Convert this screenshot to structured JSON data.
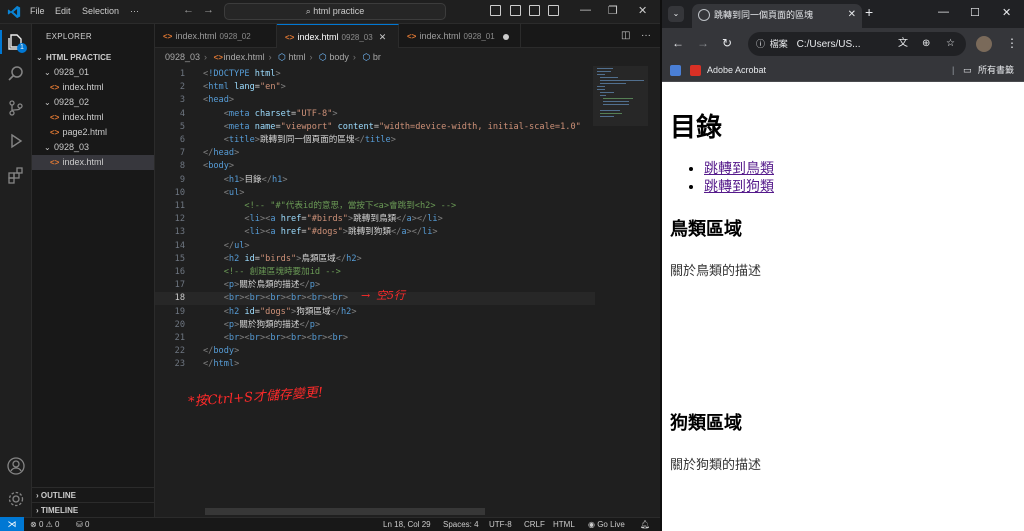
{
  "vscode": {
    "menu": [
      "File",
      "Edit",
      "Selection"
    ],
    "command_center": "html practice",
    "activity_badge": "1",
    "sidebar": {
      "header": "EXPLORER",
      "project": "HTML PRACTICE",
      "tree": [
        {
          "label": "0928_01",
          "kind": "folder"
        },
        {
          "label": "index.html",
          "kind": "file"
        },
        {
          "label": "0928_02",
          "kind": "folder"
        },
        {
          "label": "index.html",
          "kind": "file"
        },
        {
          "label": "page2.html",
          "kind": "file"
        },
        {
          "label": "0928_03",
          "kind": "folder"
        },
        {
          "label": "index.html",
          "kind": "file",
          "selected": true
        }
      ],
      "outline": "OUTLINE",
      "timeline": "TIMELINE"
    },
    "tabs": [
      {
        "name": "index.html",
        "dir": "0928_02"
      },
      {
        "name": "index.html",
        "dir": "0928_03",
        "active": true
      },
      {
        "name": "index.html",
        "dir": "0928_01",
        "dirty": true
      }
    ],
    "breadcrumb": [
      "0928_03",
      "index.html",
      "html",
      "body",
      "br"
    ],
    "code_lines": [
      {
        "n": "1",
        "html": "<span class=\"t-punct\">&lt;</span><span class=\"t-tag\">!DOCTYPE</span> <span class=\"t-attr\">html</span><span class=\"t-punct\">&gt;</span>"
      },
      {
        "n": "2",
        "html": "<span class=\"t-punct\">&lt;</span><span class=\"t-tag\">html</span> <span class=\"t-attr\">lang</span>=<span class=\"t-str\">\"en\"</span><span class=\"t-punct\">&gt;</span>"
      },
      {
        "n": "3",
        "html": "<span class=\"t-punct\">&lt;</span><span class=\"t-tag\">head</span><span class=\"t-punct\">&gt;</span>"
      },
      {
        "n": "4",
        "html": "    <span class=\"t-punct\">&lt;</span><span class=\"t-tag\">meta</span> <span class=\"t-attr\">charset</span>=<span class=\"t-str\">\"UTF-8\"</span><span class=\"t-punct\">&gt;</span>"
      },
      {
        "n": "5",
        "html": "    <span class=\"t-punct\">&lt;</span><span class=\"t-tag\">meta</span> <span class=\"t-attr\">name</span>=<span class=\"t-str\">\"viewport\"</span> <span class=\"t-attr\">content</span>=<span class=\"t-str\">\"width=device-width, initial-scale=1.0\"</span>"
      },
      {
        "n": "6",
        "html": "    <span class=\"t-punct\">&lt;</span><span class=\"t-tag\">title</span><span class=\"t-punct\">&gt;</span><span class=\"t-txt\">跳轉到同一個頁面的區塊</span><span class=\"t-punct\">&lt;/</span><span class=\"t-tag\">title</span><span class=\"t-punct\">&gt;</span>"
      },
      {
        "n": "7",
        "html": "<span class=\"t-punct\">&lt;/</span><span class=\"t-tag\">head</span><span class=\"t-punct\">&gt;</span>"
      },
      {
        "n": "8",
        "html": "<span class=\"t-punct\">&lt;</span><span class=\"t-tag\">body</span><span class=\"t-punct\">&gt;</span>"
      },
      {
        "n": "9",
        "html": "    <span class=\"t-punct\">&lt;</span><span class=\"t-tag\">h1</span><span class=\"t-punct\">&gt;</span><span class=\"t-txt\">目錄</span><span class=\"t-punct\">&lt;/</span><span class=\"t-tag\">h1</span><span class=\"t-punct\">&gt;</span>"
      },
      {
        "n": "10",
        "html": "    <span class=\"t-punct\">&lt;</span><span class=\"t-tag\">ul</span><span class=\"t-punct\">&gt;</span>"
      },
      {
        "n": "11",
        "html": "        <span class=\"t-cmt\">&lt;!-- \"#\"代表id的意思，當按下&lt;a&gt;會跳到&lt;h2&gt; --&gt;</span>"
      },
      {
        "n": "12",
        "html": "        <span class=\"t-punct\">&lt;</span><span class=\"t-tag\">li</span><span class=\"t-punct\">&gt;&lt;</span><span class=\"t-tag\">a</span> <span class=\"t-attr\">href</span>=<span class=\"t-str\">\"#birds\"</span><span class=\"t-punct\">&gt;</span><span class=\"t-txt\">跳轉到鳥類</span><span class=\"t-punct\">&lt;/</span><span class=\"t-tag\">a</span><span class=\"t-punct\">&gt;&lt;/</span><span class=\"t-tag\">li</span><span class=\"t-punct\">&gt;</span>"
      },
      {
        "n": "13",
        "html": "        <span class=\"t-punct\">&lt;</span><span class=\"t-tag\">li</span><span class=\"t-punct\">&gt;&lt;</span><span class=\"t-tag\">a</span> <span class=\"t-attr\">href</span>=<span class=\"t-str\">\"#dogs\"</span><span class=\"t-punct\">&gt;</span><span class=\"t-txt\">跳轉到狗類</span><span class=\"t-punct\">&lt;/</span><span class=\"t-tag\">a</span><span class=\"t-punct\">&gt;&lt;/</span><span class=\"t-tag\">li</span><span class=\"t-punct\">&gt;</span>"
      },
      {
        "n": "14",
        "html": "    <span class=\"t-punct\">&lt;/</span><span class=\"t-tag\">ul</span><span class=\"t-punct\">&gt;</span>"
      },
      {
        "n": "15",
        "html": "    <span class=\"t-punct\">&lt;</span><span class=\"t-tag\">h2</span> <span class=\"t-attr\">id</span>=<span class=\"t-str\">\"birds\"</span><span class=\"t-punct\">&gt;</span><span class=\"t-txt\">鳥類區域</span><span class=\"t-punct\">&lt;/</span><span class=\"t-tag\">h2</span><span class=\"t-punct\">&gt;</span>"
      },
      {
        "n": "16",
        "html": "    <span class=\"t-cmt\">&lt;!-- 創建區塊時要加id --&gt;</span>"
      },
      {
        "n": "17",
        "html": "    <span class=\"t-punct\">&lt;</span><span class=\"t-tag\">p</span><span class=\"t-punct\">&gt;</span><span class=\"t-txt\">關於鳥類的描述</span><span class=\"t-punct\">&lt;/</span><span class=\"t-tag\">p</span><span class=\"t-punct\">&gt;</span>"
      },
      {
        "n": "18",
        "html": "    <span class=\"t-punct\">&lt;</span><span class=\"t-tag\">br</span><span class=\"t-punct\">&gt;&lt;</span><span class=\"t-tag\">br</span><span class=\"t-punct\">&gt;&lt;</span><span class=\"t-tag\">br</span><span class=\"t-punct\">&gt;&lt;</span><span class=\"t-tag\">br</span><span class=\"t-punct\">&gt;&lt;</span><span class=\"t-tag\">br</span><span class=\"t-punct\">&gt;&lt;</span><span class=\"t-tag\">br</span><span class=\"t-punct\">&gt;</span>",
        "current": true
      },
      {
        "n": "19",
        "html": "    <span class=\"t-punct\">&lt;</span><span class=\"t-tag\">h2</span> <span class=\"t-attr\">id</span>=<span class=\"t-str\">\"dogs\"</span><span class=\"t-punct\">&gt;</span><span class=\"t-txt\">狗類區域</span><span class=\"t-punct\">&lt;/</span><span class=\"t-tag\">h2</span><span class=\"t-punct\">&gt;</span>"
      },
      {
        "n": "20",
        "html": "    <span class=\"t-punct\">&lt;</span><span class=\"t-tag\">p</span><span class=\"t-punct\">&gt;</span><span class=\"t-txt\">關於狗類的描述</span><span class=\"t-punct\">&lt;/</span><span class=\"t-tag\">p</span><span class=\"t-punct\">&gt;</span>"
      },
      {
        "n": "21",
        "html": "    <span class=\"t-punct\">&lt;</span><span class=\"t-tag\">br</span><span class=\"t-punct\">&gt;&lt;</span><span class=\"t-tag\">br</span><span class=\"t-punct\">&gt;&lt;</span><span class=\"t-tag\">br</span><span class=\"t-punct\">&gt;&lt;</span><span class=\"t-tag\">br</span><span class=\"t-punct\">&gt;&lt;</span><span class=\"t-tag\">br</span><span class=\"t-punct\">&gt;&lt;</span><span class=\"t-tag\">br</span><span class=\"t-punct\">&gt;</span>"
      },
      {
        "n": "22",
        "html": "<span class=\"t-punct\">&lt;/</span><span class=\"t-tag\">body</span><span class=\"t-punct\">&gt;</span>"
      },
      {
        "n": "23",
        "html": "<span class=\"t-punct\">&lt;/</span><span class=\"t-tag\">html</span><span class=\"t-punct\">&gt;</span>"
      }
    ],
    "annotation_line18": "空5行",
    "annotation_save": "*按Ctrl+S才儲存變更!",
    "status": {
      "errors": "0",
      "warnings": "0",
      "ports": "0",
      "position": "Ln 18, Col 29",
      "spaces": "Spaces: 4",
      "encoding": "UTF-8",
      "eol": "CRLF",
      "language": "HTML",
      "golive": "Go Live"
    }
  },
  "chrome": {
    "tab_title": "跳轉到同一個頁面的區塊",
    "address_chip": "檔案",
    "address": "C:/Users/US...",
    "bookmark": "Adobe Acrobat",
    "all_bookmarks": "所有書籤",
    "page": {
      "h1": "目錄",
      "links": [
        "跳轉到鳥類",
        "跳轉到狗類"
      ],
      "birds_heading": "鳥類區域",
      "birds_desc": "關於鳥類的描述",
      "dogs_heading": "狗類區域",
      "dogs_desc": "關於狗類的描述"
    }
  },
  "colors": {
    "accent": "#0078d4",
    "annotation": "#ff2a2a",
    "link_visited": "#551a8b"
  }
}
